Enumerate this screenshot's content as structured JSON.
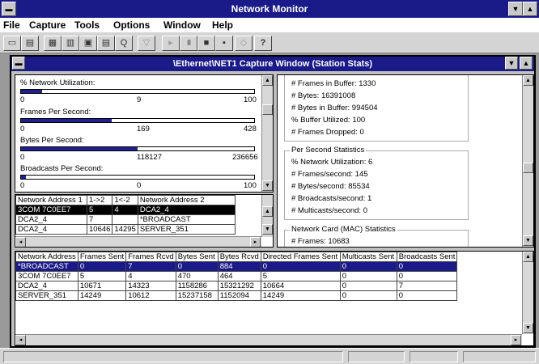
{
  "app": {
    "title": "Network Monitor"
  },
  "menu": {
    "file": "File",
    "capture": "Capture",
    "tools": "Tools",
    "options": "Options",
    "window": "Window",
    "help": "Help"
  },
  "capture_window": {
    "title": "\\Ethernet\\NET1 Capture Window (Station Stats)"
  },
  "graphs": {
    "utilization": {
      "label": "% Network Utilization:",
      "min": "0",
      "current": "9",
      "max": "100",
      "level": 0.09
    },
    "frames": {
      "label": "Frames Per Second:",
      "min": "0",
      "current": "169",
      "max": "428",
      "level": 0.39
    },
    "bytes": {
      "label": "Bytes Per Second:",
      "min": "0",
      "current": "118127",
      "max": "236656",
      "level": 0.5
    },
    "broadcasts": {
      "label": "Broadcasts Per Second:",
      "min": "0",
      "current": "0",
      "max": "100",
      "level": 0.02
    }
  },
  "stats": {
    "frames_in_buffer": "# Frames in Buffer: 1330",
    "bytes": "# Bytes: 16391008",
    "bytes_in_buffer": "# Bytes in Buffer: 994504",
    "buffer_utilized": "% Buffer Utilized: 100",
    "frames_dropped": "# Frames Dropped: 0",
    "per_second_title": "Per Second Statistics",
    "ps_util": "% Network Utilization: 6",
    "ps_frames": "# Frames/second: 145",
    "ps_bytes": "# Bytes/second: 85534",
    "ps_broadcasts": "# Broadcasts/second: 1",
    "ps_multicasts": "# Multicasts/second: 0",
    "mac_title": "Network Card (MAC) Statistics",
    "mac_frames": "# Frames: 10683"
  },
  "pairs": {
    "headers": [
      "Network Address 1",
      "1->2",
      "1<-2",
      "Network Address 2"
    ],
    "rows": [
      [
        "3COM 7C0EE7",
        "5",
        "4",
        "DCA2_4"
      ],
      [
        "DCA2_4",
        "7",
        "",
        "*BROADCAST"
      ],
      [
        "DCA2_4",
        "10646",
        "14295",
        "SERVER_351"
      ]
    ]
  },
  "stations": {
    "headers": [
      "Network Address",
      "Frames Sent",
      "Frames Rcvd",
      "Bytes Sent",
      "Bytes Rcvd",
      "Directed Frames Sent",
      "Multicasts Sent",
      "Broadcasts Sent"
    ],
    "rows": [
      [
        "*BROADCAST",
        "0",
        "7",
        "0",
        "884",
        "0",
        "0",
        "0"
      ],
      [
        "3COM 7C0EE7",
        "5",
        "4",
        "470",
        "464",
        "5",
        "0",
        "0"
      ],
      [
        "DCA2_4",
        "10671",
        "14323",
        "1158286",
        "15321292",
        "10664",
        "0",
        "7"
      ],
      [
        "SERVER_351",
        "14249",
        "10612",
        "15237158",
        "1152094",
        "14249",
        "0",
        "0"
      ]
    ]
  },
  "toolbar": {
    "help_glyph": "?"
  },
  "colors": {
    "title_bar": "#1a1a88",
    "highlight": "#1a1a88",
    "selection": "#000000"
  }
}
